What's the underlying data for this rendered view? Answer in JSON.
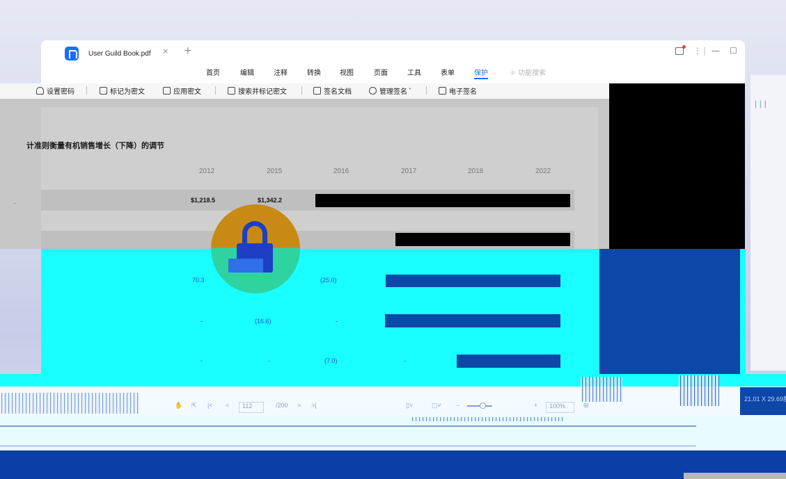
{
  "window": {
    "tab_title": "User Guild Book.pdf",
    "tab_close": "×",
    "tab_add": "+",
    "controls": {
      "more": "⋮",
      "minimize": "—",
      "maximize": "☐"
    }
  },
  "menu": {
    "items": [
      "首页",
      "编辑",
      "注释",
      "转换",
      "视图",
      "页面",
      "工具",
      "表单",
      "保护"
    ],
    "active": "保护",
    "search_placeholder": "功能搜索",
    "search_icon": "lightbulb-icon"
  },
  "toolbar": {
    "items": [
      {
        "label": "设置密码",
        "icon": "lock-icon"
      },
      {
        "label": "标记为密文",
        "icon": "mark-redact-icon"
      },
      {
        "label": "应用密文",
        "icon": "apply-redact-icon"
      },
      {
        "label": "搜索并标记密文",
        "icon": "search-redact-icon"
      },
      {
        "label": "签名文档",
        "icon": "sign-document-icon"
      },
      {
        "label": "管理签名",
        "icon": "manage-signature-icon",
        "has_dropdown": true
      },
      {
        "label": "电子签名",
        "icon": "e-signature-icon"
      }
    ]
  },
  "document": {
    "title": "计准则衡量有机销售增长（下降）的调节",
    "columns": [
      "2012",
      "2015",
      "2016",
      "2017",
      "2018",
      "2022"
    ],
    "row1": {
      "2012": "$1,218.5",
      "2015": "$1,342.2"
    },
    "row3": {
      "2012": "70.3",
      "2016": "(25.0)"
    },
    "row4": {
      "2012": "-",
      "2015": "(16.6)",
      "2016": "-"
    },
    "row5": {
      "2012": "-",
      "2015": "-",
      "2016": "(7.0)",
      "2017": "-"
    },
    "left_dash": "-"
  },
  "statusbar": {
    "page_current": "112",
    "page_total": "/200",
    "zoom": "100%",
    "dimensions": "21.01 X 29.69厘"
  },
  "colors": {
    "accent": "#1b6ff5",
    "cyan": "#19ffff",
    "navy": "#0d47a8",
    "lock_orange": "#c98a15",
    "lock_green": "#2fd3a0"
  }
}
